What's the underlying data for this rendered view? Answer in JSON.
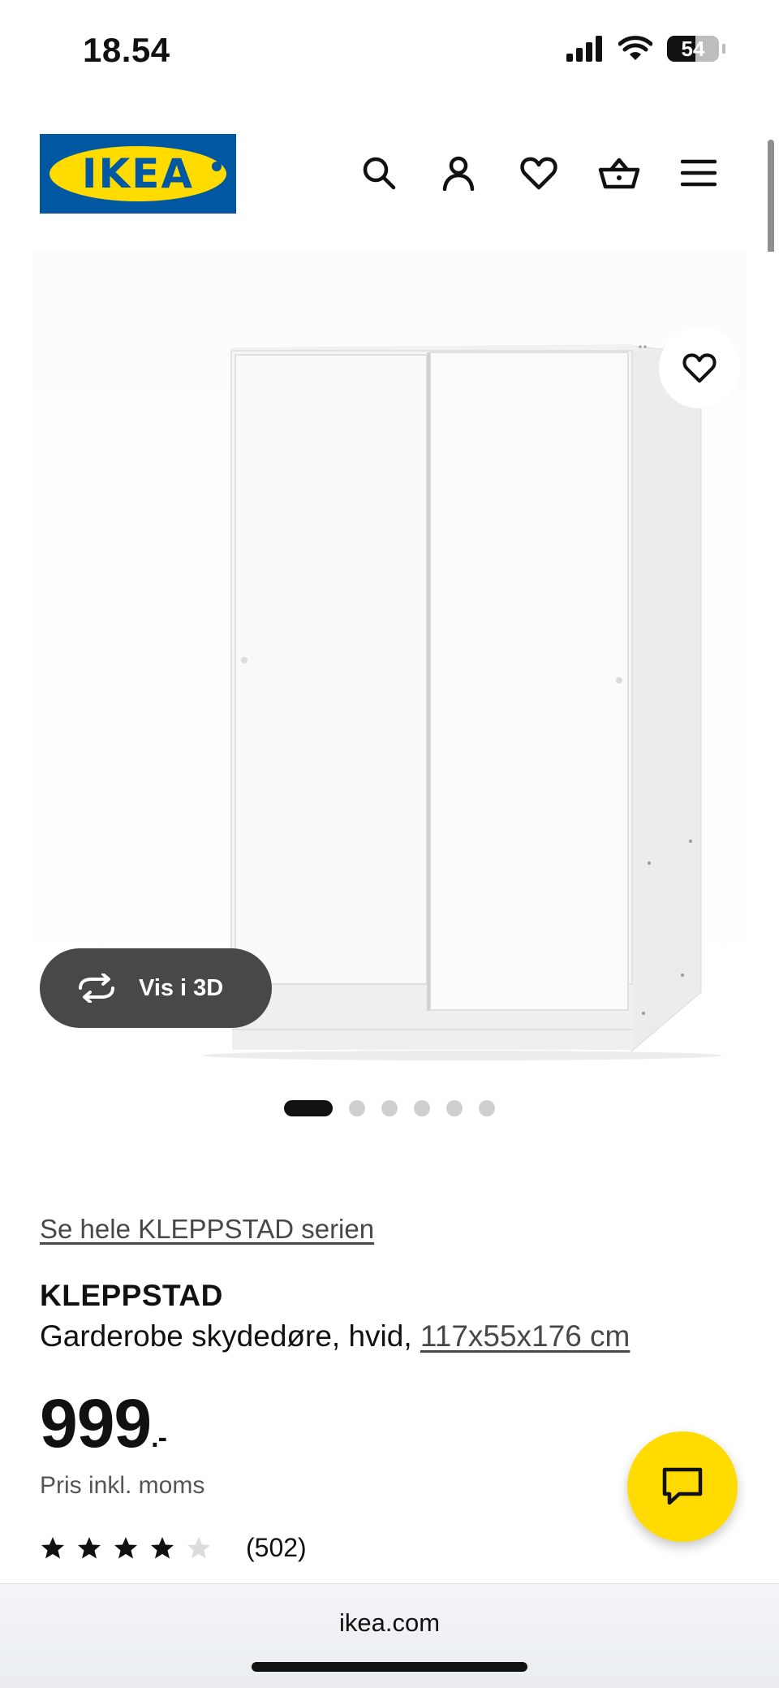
{
  "status_bar": {
    "time": "18.54",
    "battery": "54",
    "battery_level": 0.54
  },
  "header": {
    "logo_text": "IKEA",
    "icons": [
      "search-icon",
      "account-icon",
      "heart-icon",
      "basket-icon",
      "menu-icon"
    ]
  },
  "gallery": {
    "view_3d_label": "Vis i 3D",
    "image_count": 6,
    "active_index": 0
  },
  "product": {
    "series_link": "Se hele KLEPPSTAD serien",
    "name": "KLEPPSTAD",
    "description": "Garderobe skydedøre, hvid, ",
    "dimensions": "117x55x176 cm",
    "price": "999",
    "price_suffix": ".-",
    "price_note": "Pris inkl. moms",
    "rating": 4,
    "rating_max": 5,
    "review_count": "(502)"
  },
  "browser": {
    "url": "ikea.com"
  },
  "colors": {
    "ikea_blue": "#0058a3",
    "ikea_yellow": "#ffdb00"
  }
}
